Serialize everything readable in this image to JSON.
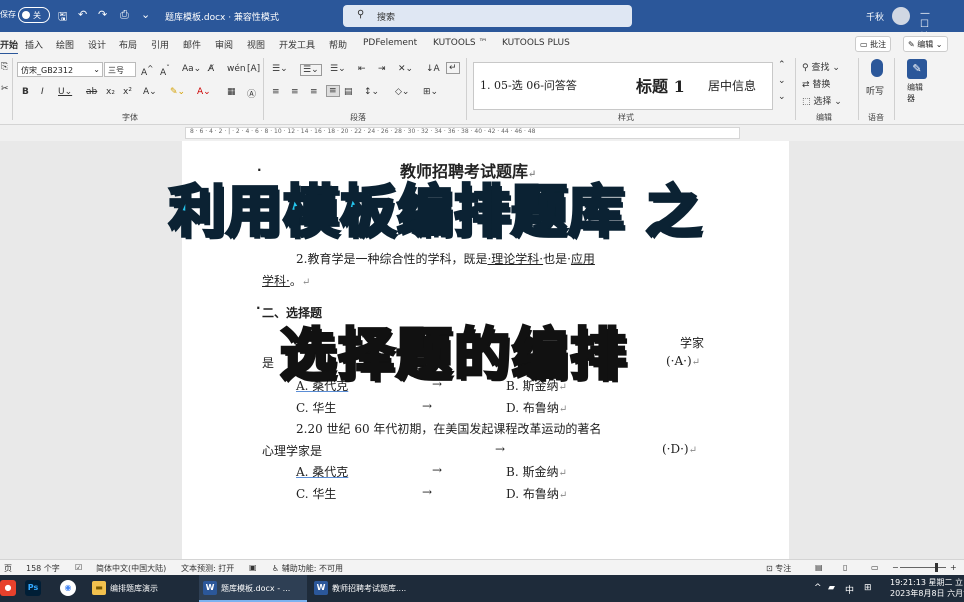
{
  "titlebar": {
    "autosave_label": "保存",
    "toggle_state": "关",
    "document_title": "题库模板.docx · 兼容性模式",
    "search_placeholder": "搜索",
    "user_name": "千秋",
    "window_controls": "— ☐ ✕"
  },
  "tabs": {
    "items": [
      "开始",
      "插入",
      "绘图",
      "设计",
      "布局",
      "引用",
      "邮件",
      "审阅",
      "视图",
      "开发工具",
      "帮助",
      "PDFelement",
      "KUTOOLS ™",
      "KUTOOLS PLUS"
    ],
    "active": "开始",
    "comment_button": "批注",
    "edit_button": "编辑"
  },
  "ribbon": {
    "font_name": "仿宋_GB2312",
    "font_size": "三号",
    "groups": {
      "font": "字体",
      "paragraph": "段落",
      "styles": "样式",
      "editing": "编辑",
      "voice": "语音"
    },
    "styles": {
      "item1": "1.  05-选 06-问答答",
      "item2": "标题 1",
      "item3": "居中信息"
    },
    "editing": {
      "find": "查找",
      "replace": "替换",
      "select": "选择"
    },
    "voice": {
      "dictate": "听写"
    },
    "editor": {
      "label": "编辑器"
    }
  },
  "ruler": {
    "ticks": "8 · 6 · 4 · 2 · | · 2 · 4 · 6 · 8 · 10 · 12 · 14 · 16 · 18 · 20 · 22 · 24 · 26 · 28 · 30 · 32 · 34 · 36 · 38 · 40 · 42 · 44 · 46 · 48"
  },
  "document": {
    "heading": "教师招聘考试题库",
    "q1_fill_line": "2.教育学是一种综合性的学科，既是",
    "q1_blank1": "·理论学科·",
    "q1_mid": "也是·",
    "q1_blank2": "应用",
    "q1_line2_blank": "学科·",
    "q1_line2_end": "。",
    "section2": "二、选择题",
    "mc1_tail": "学家",
    "mc1_line2_start": "是",
    "mc1_answer": "(·A·)",
    "mc1_A": "A.  桑代克",
    "mc1_B": "B.  斯金纳",
    "mc1_C": "C.  华生",
    "mc1_D": "D.  布鲁纳",
    "mc2_line1": "2.20  世纪  60  年代初期，在美国发起课程改革运动的著名",
    "mc2_line2": "心理学家是",
    "mc2_answer": "(·D·)",
    "mc2_A": "A.  桑代克",
    "mc2_B": "B.  斯金纳",
    "mc2_C": "C.  华生",
    "mc2_D": "D.  布鲁纳",
    "arrow": "→",
    "para_mark": "↵"
  },
  "overlay": {
    "line1": "利用模板编排题库 之",
    "line2": "选择题的编排"
  },
  "statusbar": {
    "page": "页",
    "word_count": "158 个字",
    "language": "简体中文(中国大陆)",
    "text_prediction": "文本预测: 打开",
    "accessibility": "辅助功能: 不可用",
    "focus": "专注"
  },
  "taskbar": {
    "apps": [
      {
        "label": "编排题库演示",
        "icon": "folder-icon"
      },
      {
        "label": "题库模板.docx - ...",
        "icon": "word-icon",
        "active": true
      },
      {
        "label": "教师招聘考试题库....",
        "icon": "word-icon"
      }
    ],
    "ime": "中",
    "time": "19:21:13 星期二 立",
    "date": "2023年8月8日 六月廿"
  },
  "colors": {
    "word_blue": "#2b579a",
    "overlay1_fill": "#25c6ee",
    "overlay2_fill": "#f4a488"
  }
}
